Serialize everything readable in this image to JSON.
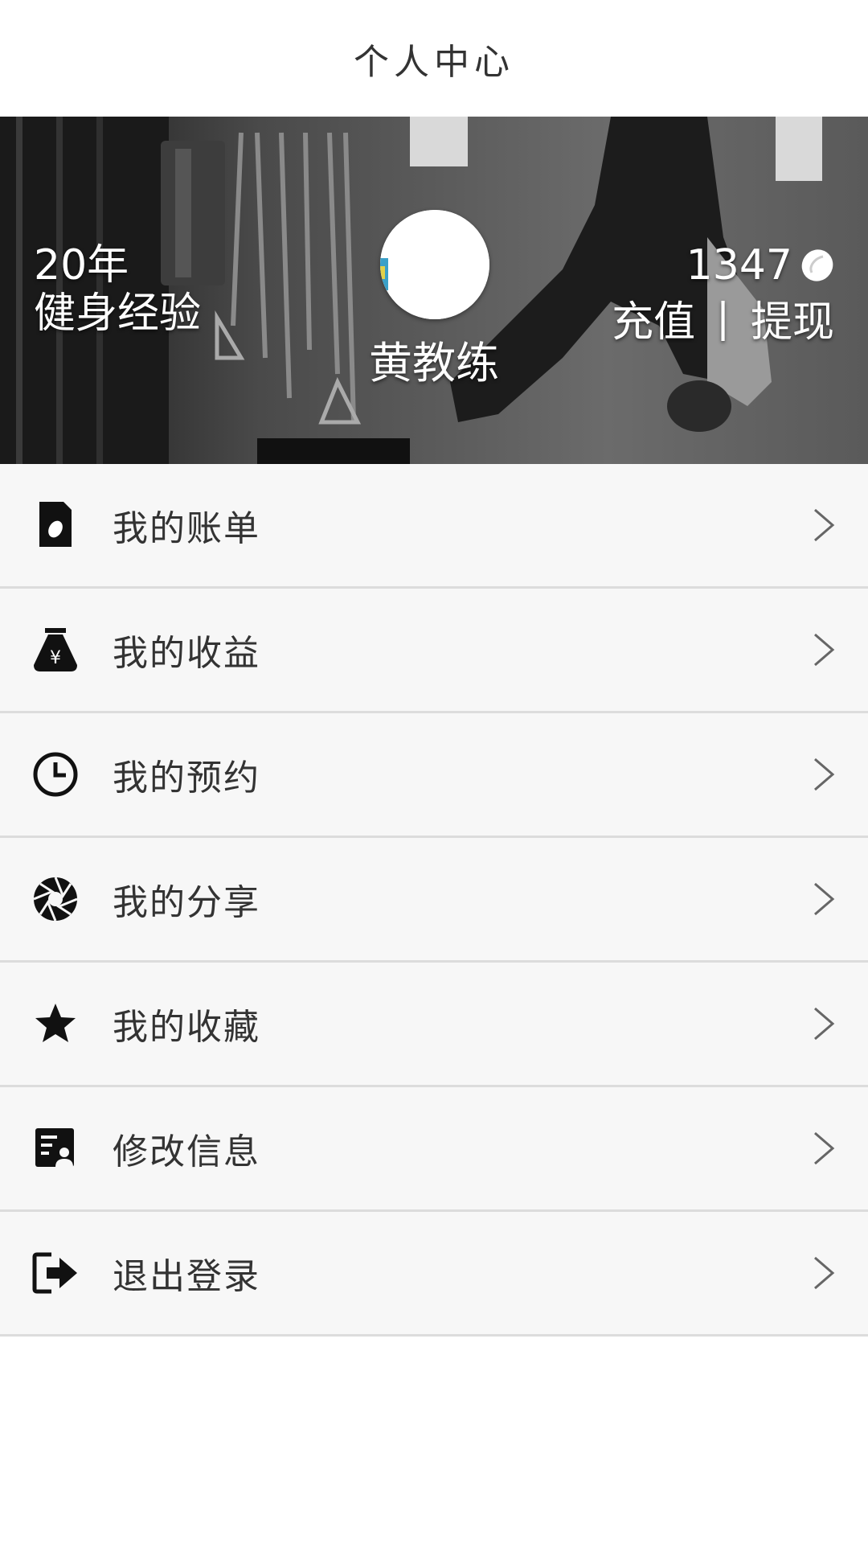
{
  "header": {
    "title": "个人中心"
  },
  "profile": {
    "experience_years": "20年",
    "experience_label": "健身经验",
    "name": "黄教练",
    "balance": "1347",
    "recharge_label": "充值",
    "separator": "|",
    "withdraw_label": "提现"
  },
  "menu": {
    "items": [
      {
        "label": "我的账单",
        "icon": "bill-icon"
      },
      {
        "label": "我的收益",
        "icon": "money-bag-icon"
      },
      {
        "label": "我的预约",
        "icon": "clock-icon"
      },
      {
        "label": "我的分享",
        "icon": "aperture-icon"
      },
      {
        "label": "我的收藏",
        "icon": "star-icon"
      },
      {
        "label": "修改信息",
        "icon": "profile-edit-icon"
      },
      {
        "label": "退出登录",
        "icon": "logout-icon"
      }
    ]
  },
  "colors": {
    "text_primary": "#333333",
    "menu_background": "#f7f7f7",
    "divider": "#dcdcdc",
    "banner_text": "#ffffff"
  }
}
